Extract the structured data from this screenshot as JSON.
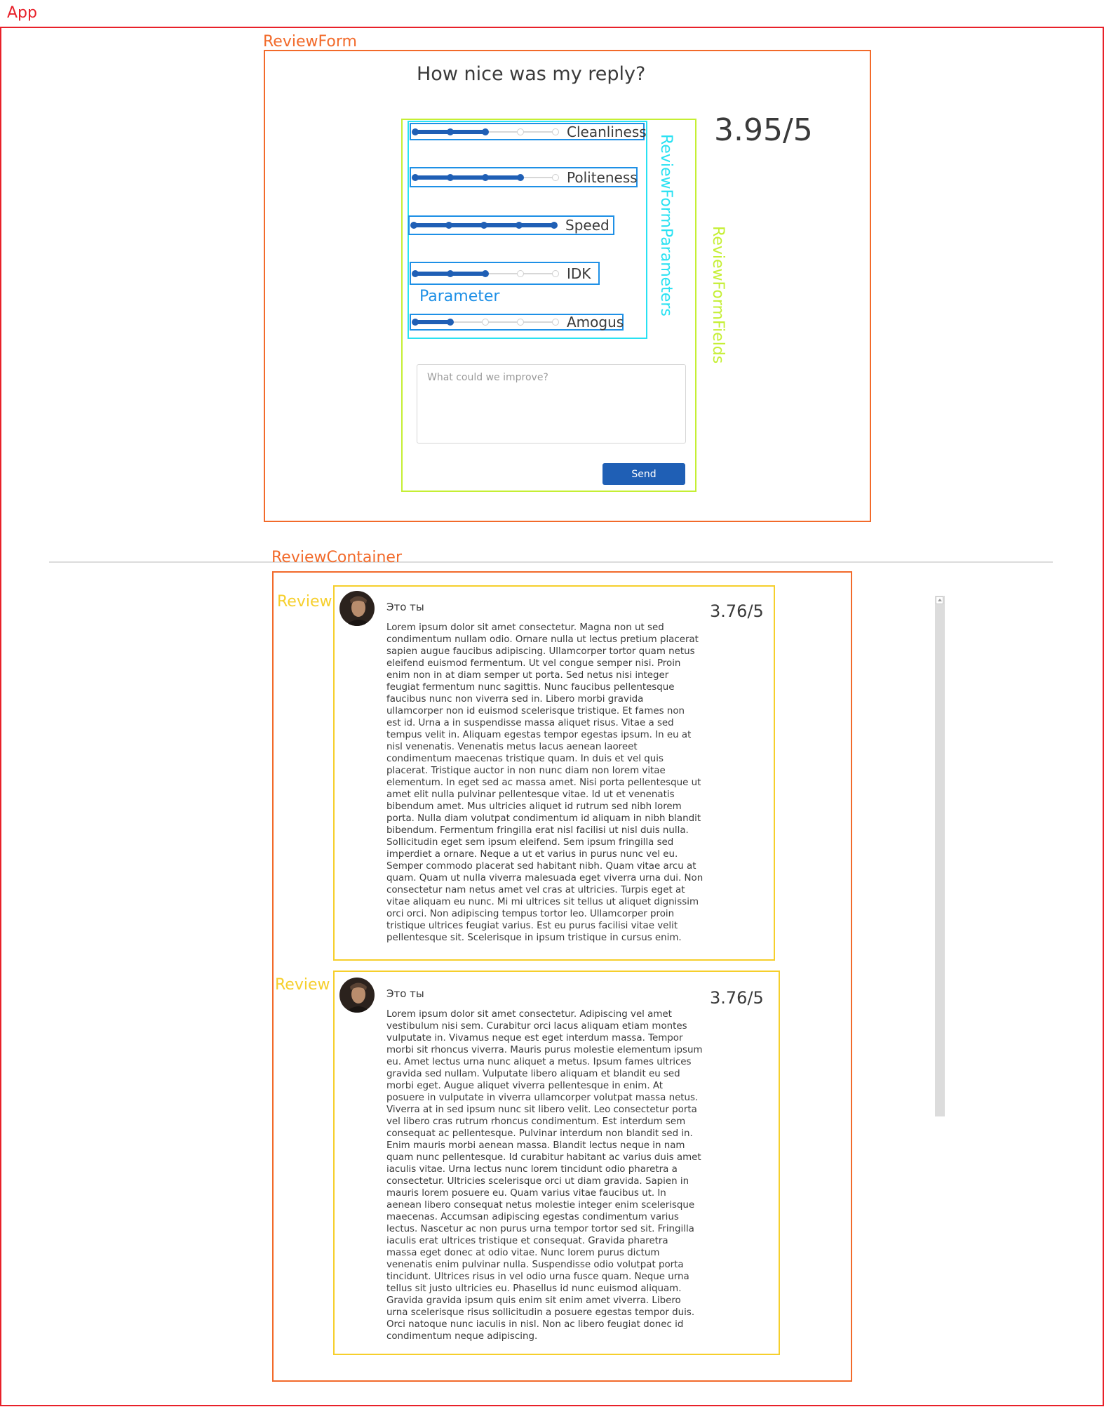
{
  "labels": {
    "app": "App",
    "review_form": "ReviewForm",
    "review_form_fields": "ReviewFormFields",
    "review_form_parameters": "ReviewFormParameters",
    "parameter": "Parameter",
    "review_container": "ReviewContainer",
    "review": "Review"
  },
  "colors": {
    "app": "#e8212a",
    "component": "#f26a2a",
    "fields": "#c5ef34",
    "parameters": "#29e1f2",
    "parameter": "#1e90e6",
    "review": "#f6cf2c",
    "accent": "#1f5fb5"
  },
  "form": {
    "title": "How nice was my reply?",
    "total_score": "3.95/5",
    "parameters": [
      {
        "label": "Cleanliness",
        "value": 3,
        "max": 5
      },
      {
        "label": "Politeness",
        "value": 4,
        "max": 5
      },
      {
        "label": "Speed",
        "value": 5,
        "max": 5
      },
      {
        "label": "IDK",
        "value": 3,
        "max": 5
      },
      {
        "label": "Amogus",
        "value": 2,
        "max": 5
      }
    ],
    "improve_placeholder": "What could we improve?",
    "improve_value": "",
    "send_label": "Send"
  },
  "reviews": [
    {
      "author": "Это ты",
      "score": "3.76/5",
      "avatar_icon": "user-photo-avatar",
      "lines": [
        "Lorem ipsum dolor sit amet consectetur. Magna non ut sed",
        "condimentum nullam odio. Ornare nulla ut lectus pretium placerat",
        "sapien augue faucibus adipiscing. Ullamcorper tortor quam netus",
        "eleifend euismod fermentum. Ut vel congue semper nisi. Proin",
        "enim non in at diam semper ut porta. Sed netus nisi integer",
        "feugiat fermentum nunc sagittis. Nunc faucibus pellentesque",
        "faucibus nunc non viverra sed in. Libero morbi gravida",
        "ullamcorper non id euismod scelerisque tristique. Et fames non",
        "est id. Urna a in suspendisse massa aliquet risus. Vitae a sed",
        "tempus velit in. Aliquam egestas tempor egestas ipsum. In eu at",
        "nisl venenatis. Venenatis metus lacus aenean laoreet",
        "condimentum maecenas tristique quam. In duis et vel quis",
        "placerat. Tristique auctor in non nunc diam non lorem vitae",
        "elementum. In eget sed ac massa amet. Nisi porta pellentesque ut",
        "amet elit nulla pulvinar pellentesque vitae. Id ut et venenatis",
        "bibendum amet. Mus ultricies aliquet id rutrum sed nibh lorem",
        "porta. Nulla diam volutpat condimentum id aliquam in nibh blandit",
        "bibendum. Fermentum fringilla erat nisl facilisi ut nisl duis nulla.",
        "Sollicitudin eget sem ipsum eleifend. Sem ipsum fringilla sed",
        "imperdiet a ornare. Neque a ut et varius in purus nunc vel eu.",
        "Semper commodo placerat sed habitant nibh. Quam vitae arcu at",
        "quam. Quam ut nulla viverra malesuada eget viverra urna dui. Non",
        "consectetur nam netus amet vel cras at ultricies. Turpis eget at",
        "vitae aliquam eu nunc. Mi mi ultrices sit tellus ut aliquet dignissim",
        "orci orci. Non adipiscing tempus tortor leo. Ullamcorper proin",
        "tristique ultrices feugiat varius. Est eu purus facilisi vitae velit",
        "pellentesque sit. Scelerisque in ipsum tristique in cursus enim."
      ]
    },
    {
      "author": "Это ты",
      "score": "3.76/5",
      "avatar_icon": "user-photo-avatar",
      "lines": [
        "Lorem ipsum dolor sit amet consectetur. Adipiscing vel amet",
        "vestibulum nisi sem. Curabitur orci lacus aliquam etiam montes",
        "vulputate in. Vivamus neque est eget interdum massa. Tempor",
        "morbi sit rhoncus viverra. Mauris purus molestie elementum ipsum",
        "eu. Amet lectus urna nunc aliquet a metus. Ipsum fames ultrices",
        "gravida sed nullam. Vulputate libero aliquam et blandit eu sed",
        "morbi eget. Augue aliquet viverra pellentesque in enim. At",
        "posuere in vulputate in viverra ullamcorper volutpat massa netus.",
        "Viverra at in sed ipsum nunc sit libero velit. Leo consectetur porta",
        "vel libero cras rutrum rhoncus condimentum. Est interdum sem",
        "consequat ac pellentesque. Pulvinar interdum non blandit sed in.",
        "Enim mauris morbi aenean massa. Blandit lectus neque in nam",
        "quam nunc pellentesque. Id curabitur habitant ac varius duis amet",
        "iaculis vitae. Urna lectus nunc lorem tincidunt odio pharetra a",
        "consectetur. Ultricies scelerisque orci ut diam gravida. Sapien in",
        "mauris lorem posuere eu. Quam varius vitae faucibus ut. In",
        "aenean libero consequat netus molestie integer enim scelerisque",
        "maecenas. Accumsan adipiscing egestas condimentum varius",
        "lectus. Nascetur ac non purus urna tempor tortor sed sit. Fringilla",
        "iaculis erat ultrices tristique et consequat. Gravida pharetra",
        "massa eget donec at odio vitae. Nunc lorem purus dictum",
        "venenatis enim pulvinar nulla. Suspendisse odio volutpat porta",
        "tincidunt. Ultrices risus in vel odio urna fusce quam. Neque urna",
        "tellus sit justo ultricies eu. Phasellus id nunc euismod aliquam.",
        "Gravida gravida ipsum quis enim sit enim amet viverra. Libero",
        "urna scelerisque risus sollicitudin a posuere egestas tempor duis.",
        "Orci natoque nunc iaculis in nisl. Non ac libero feugiat donec id",
        "condimentum neque adipiscing."
      ]
    }
  ]
}
